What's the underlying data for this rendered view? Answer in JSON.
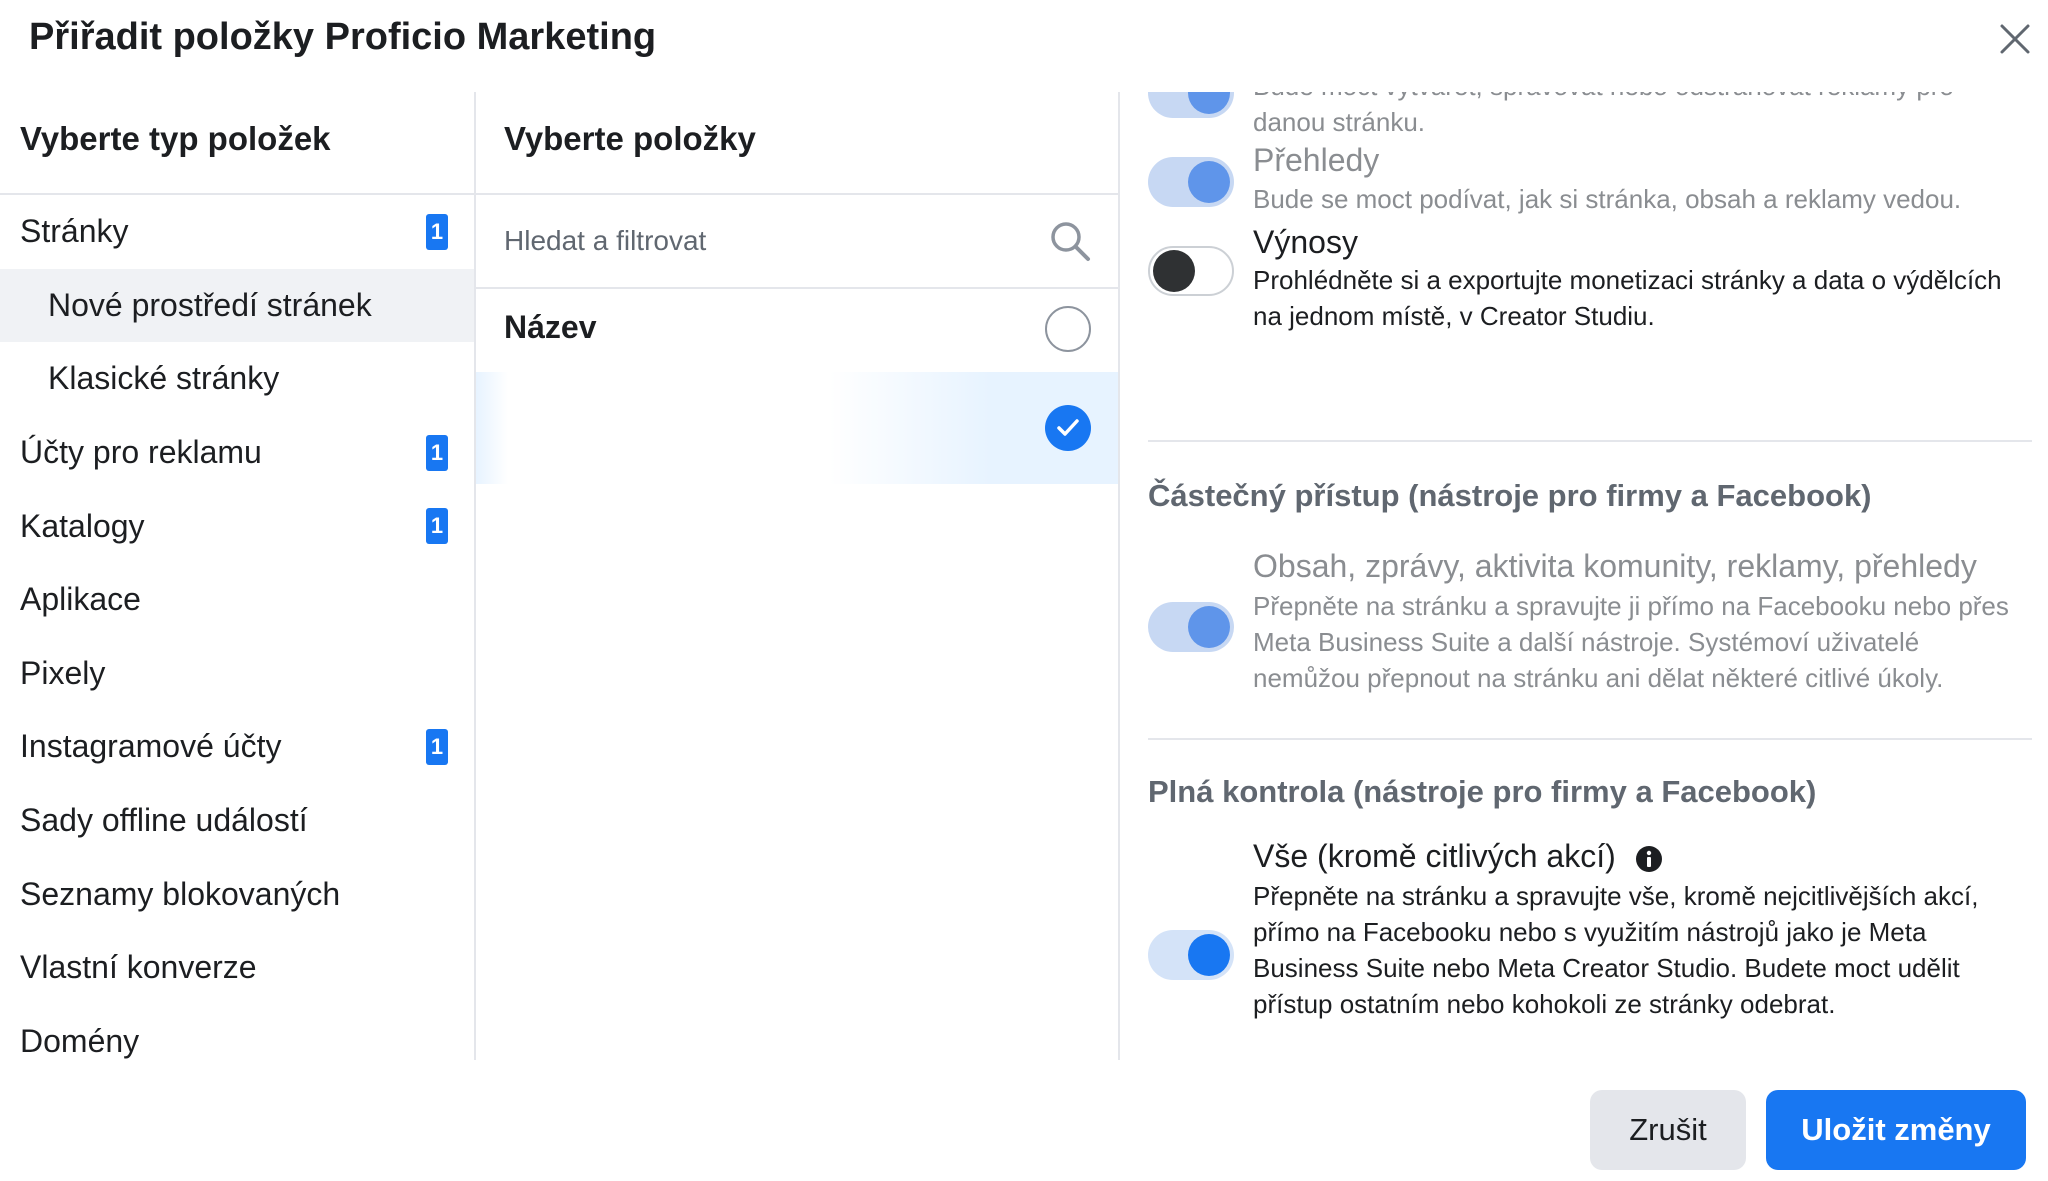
{
  "dialog": {
    "title": "Přiřadit položky Proficio Marketing"
  },
  "item_types": {
    "heading": "Vyberte typ položek",
    "items": [
      {
        "label": "Stránky",
        "badge": "1"
      },
      {
        "label": "Nové prostředí stránek"
      },
      {
        "label": "Klasické stránky"
      },
      {
        "label": "Účty pro reklamu",
        "badge": "1"
      },
      {
        "label": "Katalogy",
        "badge": "1"
      },
      {
        "label": "Aplikace"
      },
      {
        "label": "Pixely"
      },
      {
        "label": "Instagramové účty",
        "badge": "1"
      },
      {
        "label": "Sady offline událostí"
      },
      {
        "label": "Seznamy blokovaných"
      },
      {
        "label": "Vlastní konverze"
      },
      {
        "label": "Domény"
      }
    ],
    "selected": "Nové prostředí stránek"
  },
  "items_panel": {
    "heading": "Vyberte položky",
    "search_placeholder": "Hledat a filtrovat",
    "search_value": "",
    "name_header": "Název",
    "rows": [
      {
        "name": "",
        "selected": true
      }
    ]
  },
  "permissions": {
    "ads": {
      "desc": "Bude moct vytvářet, spravovat nebo odstraňovat reklamy pro danou stránku.",
      "enabled": true,
      "disabled": true
    },
    "insights": {
      "title": "Přehledy",
      "desc": "Bude se moct podívat, jak si stránka, obsah a reklamy vedou.",
      "enabled": true,
      "disabled": true
    },
    "revenue": {
      "title": "Výnosy",
      "desc": "Prohlédněte si a exportujte monetizaci stránky a data o výdělcích na jednom místě, v Creator Studiu.",
      "enabled": false,
      "disabled": false
    },
    "partial": {
      "heading": "Částečný přístup (nástroje pro firmy a Facebook)",
      "title": "Obsah, zprávy, aktivita komunity, reklamy, přehledy",
      "desc": "Přepněte na stránku a spravujte ji přímo na Facebooku nebo přes Meta Business Suite a další nástroje. Systémoví uživatelé nemůžou přepnout na stránku ani dělat některé citlivé úkoly.",
      "enabled": true,
      "disabled": true
    },
    "full": {
      "heading": "Plná kontrola (nástroje pro firmy a Facebook)",
      "title": "Vše (kromě citlivých akcí)",
      "desc": "Přepněte na stránku a spravujte vše, kromě nejcitlivějších akcí, přímo na Facebooku nebo s využitím nástrojů jako je Meta Business Suite nebo Meta Creator Studio. Budete moct udělit přístup ostatním nebo kohokoli ze stránky odebrat.",
      "enabled": true,
      "disabled": false
    }
  },
  "footer": {
    "cancel_label": "Zrušit",
    "save_label": "Uložit změny"
  },
  "colors": {
    "accent": "#1877f2",
    "badge": "#1877f2",
    "divider": "#e4e6eb",
    "selected_bg": "#f0f2f5"
  },
  "icons": {
    "close": "close-icon",
    "search": "search-icon",
    "check": "check-icon",
    "info": "info-icon"
  }
}
